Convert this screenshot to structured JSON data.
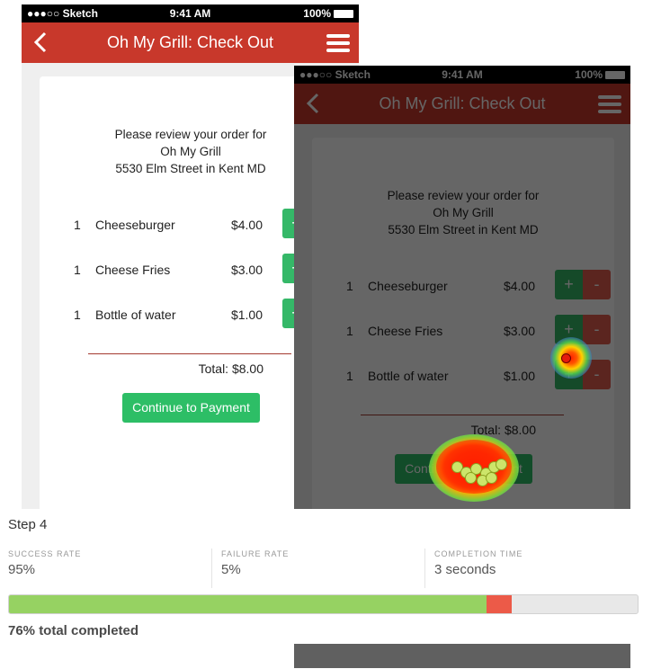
{
  "status_bar": {
    "carrier": "●●●○○ Sketch",
    "time": "9:41 AM",
    "battery": "100%"
  },
  "navbar": {
    "title": "Oh My Grill: Check Out"
  },
  "order": {
    "review_line1": "Please review your order for",
    "restaurant": "Oh My Grill",
    "address": "5530 Elm Street in Kent MD",
    "items": [
      {
        "qty": "1",
        "name": "Cheeseburger",
        "price": "$4.00"
      },
      {
        "qty": "1",
        "name": "Cheese Fries",
        "price": "$3.00"
      },
      {
        "qty": "1",
        "name": "Bottle of water",
        "price": "$1.00"
      }
    ],
    "plus_label": "+",
    "minus_label": "-",
    "total": "Total: $8.00",
    "continue_label": "Continue to Payment"
  },
  "step": {
    "title": "Step 4",
    "success_label": "SUCCESS RATE",
    "success_value": "95%",
    "failure_label": "FAILURE RATE",
    "failure_value": "5%",
    "time_label": "COMPLETION TIME",
    "time_value": "3 seconds",
    "progress": {
      "success_fraction": 0.76,
      "failure_fraction": 0.04
    },
    "completed_text": "76% total completed"
  },
  "colors": {
    "navbar": "#c8382b",
    "success": "#96d262",
    "failure": "#ec5a48",
    "pay_button": "#2dbe66"
  }
}
